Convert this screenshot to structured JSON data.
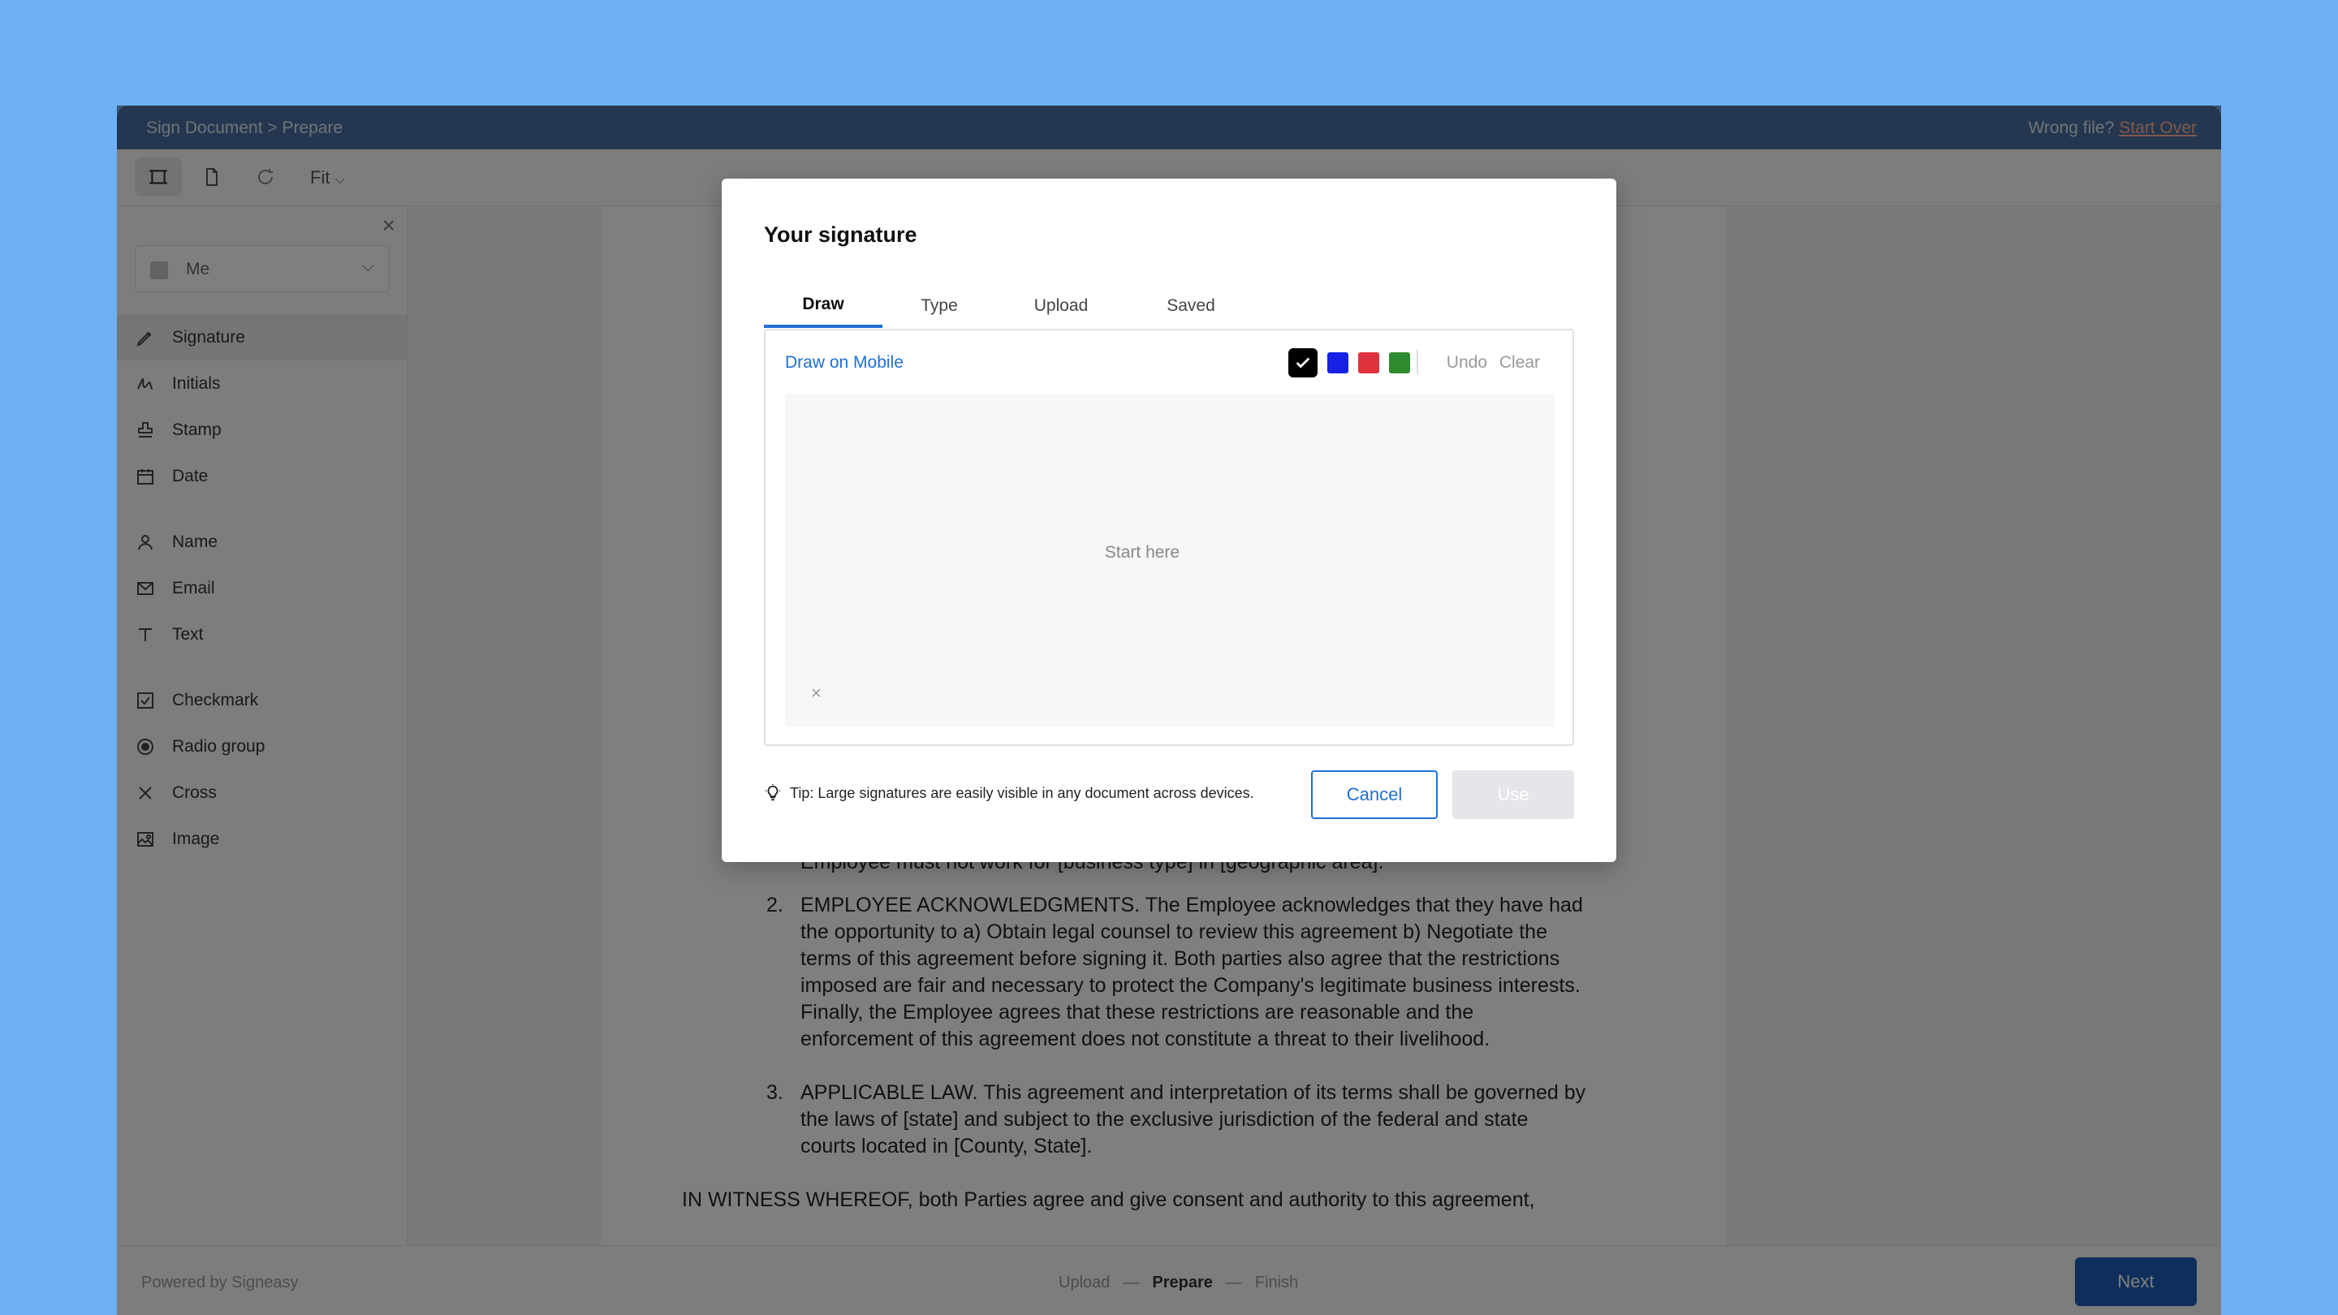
{
  "header": {
    "breadcrumb": "Sign Document > Prepare",
    "wrong_file": "Wrong file?",
    "start_over": "Start Over"
  },
  "toolbar": {
    "fit_label": "Fit"
  },
  "sidebar": {
    "recipient": "Me",
    "items": [
      {
        "label": "Signature",
        "icon": "pen-icon"
      },
      {
        "label": "Initials",
        "icon": "initials-icon"
      },
      {
        "label": "Stamp",
        "icon": "stamp-icon"
      },
      {
        "label": "Date",
        "icon": "calendar-icon"
      },
      {
        "label": "Name",
        "icon": "person-icon"
      },
      {
        "label": "Email",
        "icon": "mail-icon"
      },
      {
        "label": "Text",
        "icon": "text-icon"
      },
      {
        "label": "Checkmark",
        "icon": "checkbox-icon"
      },
      {
        "label": "Radio group",
        "icon": "radio-icon"
      },
      {
        "label": "Cross",
        "icon": "cross-icon"
      },
      {
        "label": "Image",
        "icon": "image-icon"
      }
    ]
  },
  "document": {
    "line0": "Employee must not work for [business type] in [geographic area].",
    "para2_num": "2.",
    "para2": "EMPLOYEE ACKNOWLEDGMENTS. The Employee acknowledges that they have had the opportunity to a) Obtain legal counsel to review this agreement b) Negotiate the terms of this agreement before signing it. Both parties also agree that the restrictions imposed are fair and necessary to protect the Company's legitimate business interests. Finally, the Employee agrees that these restrictions are reasonable and the enforcement of this agreement does not constitute a threat to their livelihood.",
    "para3_num": "3.",
    "para3": "APPLICABLE LAW. This agreement and interpretation of its terms shall be governed by the laws of [state] and subject to the exclusive jurisdiction of the federal and state courts located in [County, State].",
    "witness": "IN WITNESS WHEREOF, both Parties agree and give consent and authority to this agreement,"
  },
  "footer": {
    "powered": "Powered by Signeasy",
    "step1": "Upload",
    "step2": "Prepare",
    "step3": "Finish",
    "dash": "—",
    "next": "Next"
  },
  "modal": {
    "title": "Your signature",
    "tabs": [
      "Draw",
      "Type",
      "Upload",
      "Saved"
    ],
    "draw_on_mobile": "Draw on Mobile",
    "colors": [
      "#000000",
      "#1522e6",
      "#e0313f",
      "#2e8a2e"
    ],
    "undo": "Undo",
    "clear": "Clear",
    "canvas_hint": "Start here",
    "tip": "Tip: Large signatures are easily visible in any document across devices.",
    "cancel": "Cancel",
    "use": "Use"
  }
}
